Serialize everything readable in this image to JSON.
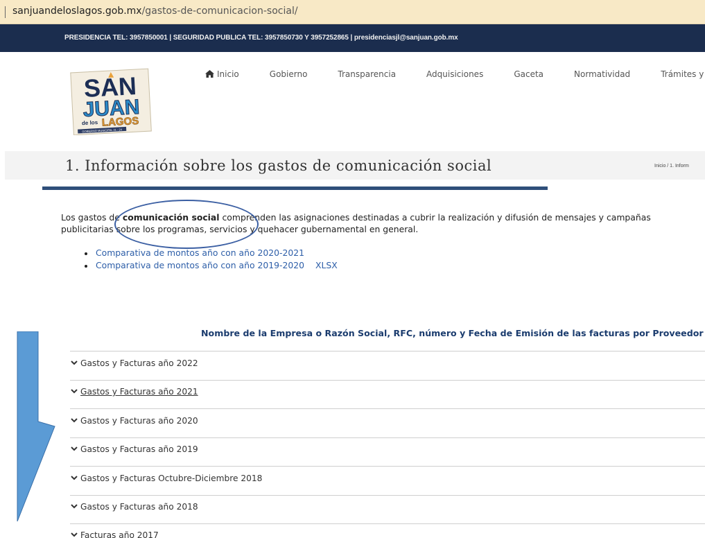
{
  "browser": {
    "url_domain": "sanjuandeloslagos.gob.mx",
    "url_path": "/gastos-de-comunicacion-social/"
  },
  "topbar": {
    "contact_text": "PRESIDENCIA TEL: 3957850001 | SEGURIDAD PUBLICA TEL: 3957850730 Y 3957252865 | presidenciasjl@sanjuan.gob.mx",
    "background": "#1b2d4e"
  },
  "logo": {
    "line1": "SAN",
    "line2": "JUAN",
    "line3": "de los",
    "line4": "LAGOS",
    "ribbon": "GOBIERNO MUNICIPAL 21 - 24"
  },
  "nav": {
    "items": [
      {
        "label": "Inicio",
        "icon": "home-icon"
      },
      {
        "label": "Gobierno"
      },
      {
        "label": "Transparencia"
      },
      {
        "label": "Adquisiciones"
      },
      {
        "label": "Gaceta"
      },
      {
        "label": "Normatividad"
      },
      {
        "label": "Trámites y"
      }
    ]
  },
  "page": {
    "title": "1. Información sobre los gastos de comunicación social",
    "breadcrumb": "Inicio / 1. Inform",
    "accent": "#2f4f7a"
  },
  "intro": {
    "part1": "Los gastos de ",
    "bold": "comunicación social",
    "part2": " comprenden las asignaciones destinadas a cubrir la realización y difusión de mensajes y campañas publicitarias sobre los programas, servicios y quehacer gubernamental en general."
  },
  "links": [
    {
      "label": "Comparativa de montos año con año 2020-2021"
    },
    {
      "label": "Comparativa de montos año con año 2019-2020",
      "extra": "XLSX"
    }
  ],
  "table": {
    "heading": "Nombre de la Empresa o Razón Social, RFC, número y Fecha de Emisión de las facturas por Proveedor",
    "items": [
      {
        "label": "Gastos y Facturas año 2022"
      },
      {
        "label": "Gastos y Facturas año 2021"
      },
      {
        "label": "Gastos y Facturas año 2020"
      },
      {
        "label": "Gastos y Facturas año 2019"
      },
      {
        "label": "Gastos y Facturas Octubre-Diciembre 2018"
      },
      {
        "label": "Gastos y Facturas año 2018"
      },
      {
        "label": "Facturas año 2017"
      }
    ]
  },
  "annotations": {
    "arrow_color": "#5b9bd5",
    "oval_color": "#3b5fa3"
  }
}
